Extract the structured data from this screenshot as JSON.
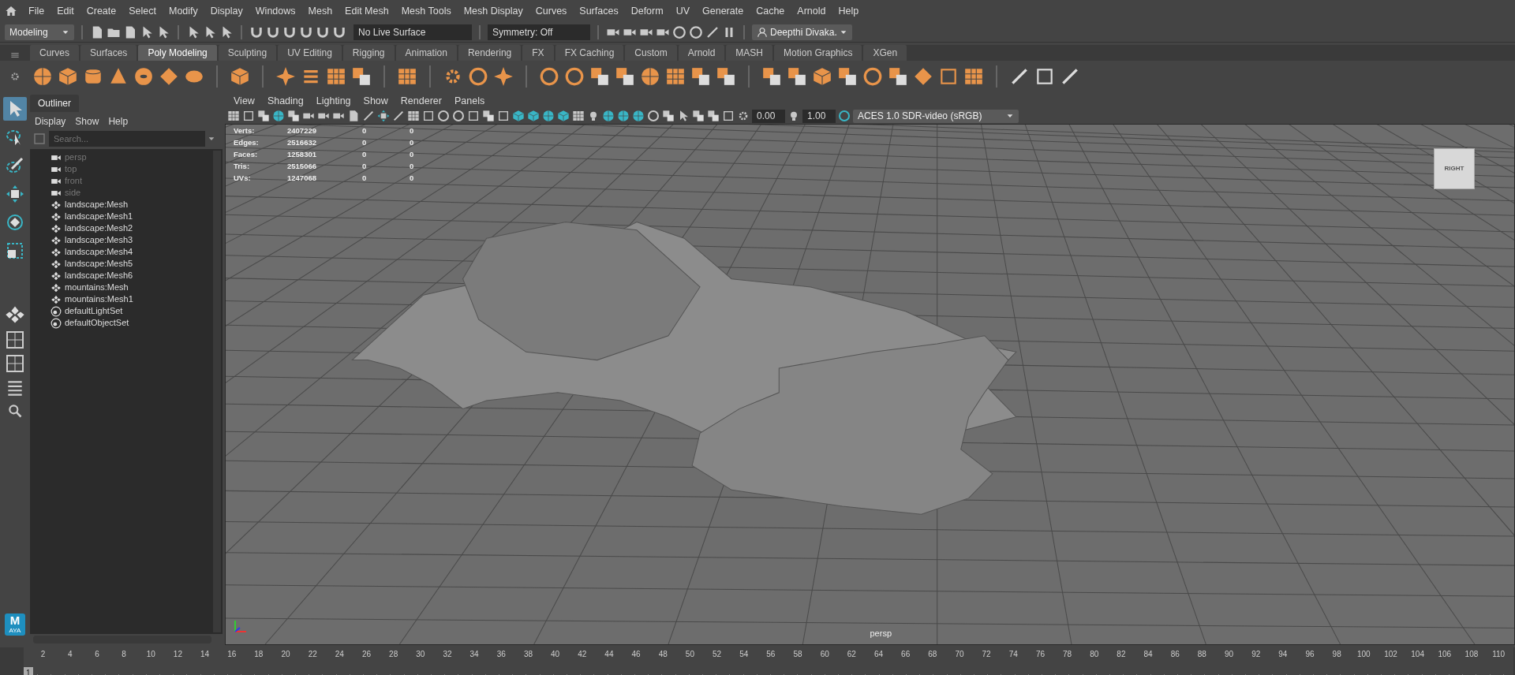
{
  "menu_bar": [
    "File",
    "Edit",
    "Create",
    "Select",
    "Modify",
    "Display",
    "Windows",
    "Mesh",
    "Edit Mesh",
    "Mesh Tools",
    "Mesh Display",
    "Curves",
    "Surfaces",
    "Deform",
    "UV",
    "Generate",
    "Cache",
    "Arnold",
    "Help"
  ],
  "status_line": {
    "mode": "Modeling",
    "live_surface": "No Live Surface",
    "symmetry": "Symmetry: Off",
    "user": "Deepthi Divaka."
  },
  "shelf_tabs": [
    {
      "label": "Curves",
      "selected": false
    },
    {
      "label": "Surfaces",
      "selected": false
    },
    {
      "label": "Poly Modeling",
      "selected": true
    },
    {
      "label": "Sculpting",
      "selected": false
    },
    {
      "label": "UV Editing",
      "selected": false
    },
    {
      "label": "Rigging",
      "selected": false
    },
    {
      "label": "Animation",
      "selected": false
    },
    {
      "label": "Rendering",
      "selected": false
    },
    {
      "label": "FX",
      "selected": false
    },
    {
      "label": "FX Caching",
      "selected": false
    },
    {
      "label": "Custom",
      "selected": false
    },
    {
      "label": "Arnold",
      "selected": false
    },
    {
      "label": "MASH",
      "selected": false
    },
    {
      "label": "Motion Graphics",
      "selected": false
    },
    {
      "label": "XGen",
      "selected": false
    }
  ],
  "toolbox": [
    {
      "selected": true
    },
    {
      "selected": false
    },
    {
      "selected": false
    },
    {
      "selected": false
    },
    {
      "selected": false
    },
    {
      "selected": false
    }
  ],
  "outliner": {
    "title": "Outliner",
    "menus": [
      "Display",
      "Show",
      "Help"
    ],
    "search": {
      "placeholder": "Search..."
    },
    "items": [
      {
        "label": "persp",
        "kind": "camera",
        "hidden": true
      },
      {
        "label": "top",
        "kind": "camera",
        "hidden": true
      },
      {
        "label": "front",
        "kind": "camera",
        "hidden": true
      },
      {
        "label": "side",
        "kind": "camera",
        "hidden": true
      },
      {
        "label": "landscape:Mesh",
        "kind": "mesh",
        "hidden": false
      },
      {
        "label": "landscape:Mesh1",
        "kind": "mesh",
        "hidden": false
      },
      {
        "label": "landscape:Mesh2",
        "kind": "mesh",
        "hidden": false
      },
      {
        "label": "landscape:Mesh3",
        "kind": "mesh",
        "hidden": false
      },
      {
        "label": "landscape:Mesh4",
        "kind": "mesh",
        "hidden": false
      },
      {
        "label": "landscape:Mesh5",
        "kind": "mesh",
        "hidden": false
      },
      {
        "label": "landscape:Mesh6",
        "kind": "mesh",
        "hidden": false
      },
      {
        "label": "mountains:Mesh",
        "kind": "mesh",
        "hidden": false
      },
      {
        "label": "mountains:Mesh1",
        "kind": "mesh",
        "hidden": false
      },
      {
        "label": "defaultLightSet",
        "kind": "set",
        "hidden": false
      },
      {
        "label": "defaultObjectSet",
        "kind": "set",
        "hidden": false
      }
    ]
  },
  "viewport": {
    "menus": [
      "View",
      "Shading",
      "Lighting",
      "Show",
      "Renderer",
      "Panels"
    ],
    "exposure": "0.00",
    "gamma": "1.00",
    "color_space": "ACES 1.0 SDR-video (sRGB)",
    "hud": [
      {
        "label": "Verts:",
        "values": [
          "2407229",
          "0",
          "0"
        ]
      },
      {
        "label": "Edges:",
        "values": [
          "2516632",
          "0",
          "0"
        ]
      },
      {
        "label": "Faces:",
        "values": [
          "1258301",
          "0",
          "0"
        ]
      },
      {
        "label": "Tris:",
        "values": [
          "2515066",
          "0",
          "0"
        ]
      },
      {
        "label": "UVs:",
        "values": [
          "1247068",
          "0",
          "0"
        ]
      }
    ],
    "view_cube": "RIGHT",
    "camera": "persp"
  },
  "logo": {
    "letter": "M",
    "caption": "AYA"
  },
  "timeline": {
    "current": "1",
    "ticks": [
      "2",
      "4",
      "6",
      "8",
      "10",
      "12",
      "14",
      "16",
      "18",
      "20",
      "22",
      "24",
      "26",
      "28",
      "30",
      "32",
      "34",
      "36",
      "38",
      "40",
      "42",
      "44",
      "46",
      "48",
      "50",
      "52",
      "54",
      "56",
      "58",
      "60",
      "62",
      "64",
      "66",
      "68",
      "70",
      "72",
      "74",
      "76",
      "78",
      "80",
      "82",
      "84",
      "86",
      "88",
      "90",
      "92",
      "94",
      "96",
      "98",
      "100",
      "102",
      "104",
      "106",
      "108",
      "110"
    ]
  }
}
